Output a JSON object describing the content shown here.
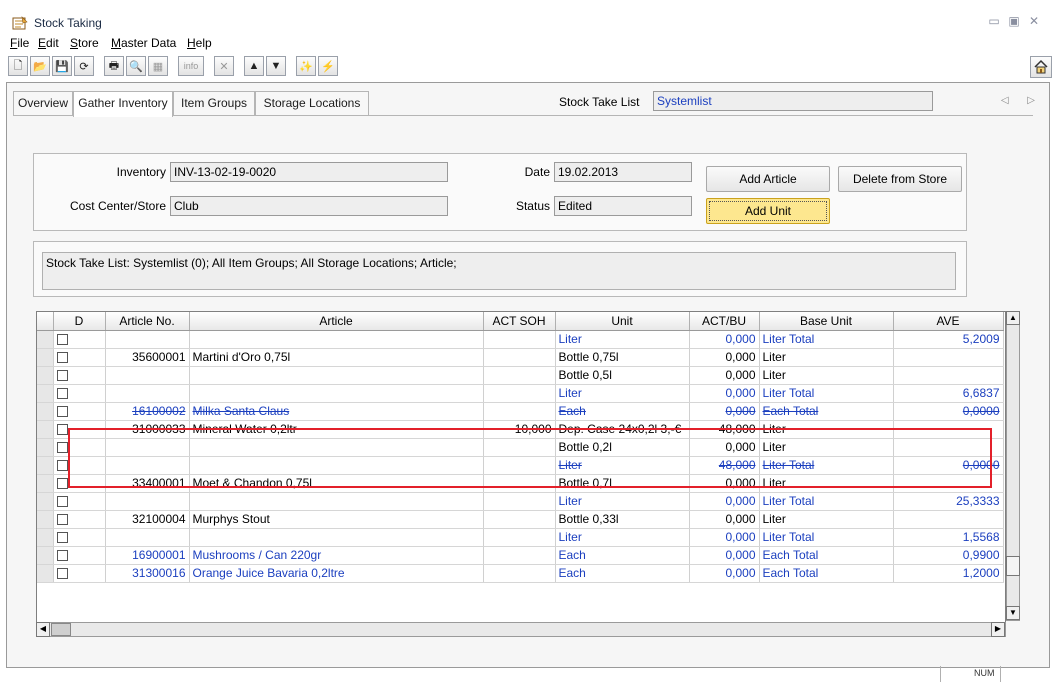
{
  "window": {
    "title": "Stock Taking",
    "controls": [
      "▭",
      "▣",
      "✕"
    ]
  },
  "menu": [
    {
      "label": "File",
      "u": "F",
      "rest": "ile"
    },
    {
      "label": "Edit",
      "u": "E",
      "rest": "dit"
    },
    {
      "label": "Store",
      "u": "S",
      "rest": "tore"
    },
    {
      "label": "Master Data",
      "u": "M",
      "rest": "aster Data"
    },
    {
      "label": "Help",
      "u": "H",
      "rest": "elp"
    }
  ],
  "toolbar": {
    "new": "🗋",
    "open": "📂",
    "save": "💾",
    "refresh": "⟳",
    "print": "🖶",
    "preview": "🔍",
    "disabled_img": "▦",
    "info": "info",
    "delete": "✕",
    "up": "▲",
    "down": "▼",
    "wand": "✨",
    "lightning": "⚡",
    "home": "⌂"
  },
  "tabs": [
    {
      "label": "Overview"
    },
    {
      "label": "Gather Inventory"
    },
    {
      "label": "Item Groups"
    },
    {
      "label": "Storage Locations"
    }
  ],
  "active_tab": "Gather Inventory",
  "stock_take_list": {
    "label": "Stock Take List",
    "value": "Systemlist"
  },
  "nav_arrows": "◁ ▷",
  "form": {
    "inventory_label": "Inventory",
    "inventory_value": "INV-13-02-19-0020",
    "cost_center_label": "Cost Center/Store",
    "cost_center_value": "Club",
    "date_label": "Date",
    "date_value": "19.02.2013",
    "status_label": "Status",
    "status_value": "Edited",
    "add_article": "Add Article",
    "delete_from_store": "Delete from Store",
    "add_unit": "Add Unit"
  },
  "filter_summary": "Stock Take List: Systemlist (0); All Item Groups; All Storage Locations; Article;",
  "grid": {
    "columns": [
      "",
      "D",
      "Article No.",
      "Article",
      "ACT SOH",
      "Unit",
      "ACT/BU",
      "Base Unit",
      "AVE"
    ],
    "rows": [
      {
        "blue": true,
        "artno": "",
        "article": "",
        "soh": "",
        "unit": "Liter",
        "actbu": "0,000",
        "base": "Liter Total",
        "ave": "5,2009"
      },
      {
        "blue": false,
        "artno": "35600001",
        "article": "Martini d'Oro 0,75l",
        "soh": "",
        "unit": "Bottle 0,75l",
        "actbu": "0,000",
        "base": "Liter",
        "ave": ""
      },
      {
        "blue": false,
        "artno": "",
        "article": "",
        "soh": "",
        "unit": "Bottle 0,5l",
        "actbu": "0,000",
        "base": "Liter",
        "ave": ""
      },
      {
        "blue": true,
        "artno": "",
        "article": "",
        "soh": "",
        "unit": "Liter",
        "actbu": "0,000",
        "base": "Liter Total",
        "ave": "6,6837"
      },
      {
        "blue": true,
        "strike": true,
        "artno": "16100002",
        "article": "Milka Santa Claus",
        "soh": "",
        "unit": "Each",
        "actbu": "0,000",
        "base": "Each Total",
        "ave": "0,0000"
      },
      {
        "blue": false,
        "artno": "31000033",
        "article": "Mineral Water 0,2ltr",
        "soh": "10,000",
        "unit": "Dep. Case 24x0,2l 3,-€",
        "actbu": "48,000",
        "base": "Liter",
        "ave": ""
      },
      {
        "blue": false,
        "artno": "",
        "article": "",
        "soh": "",
        "unit": "Bottle 0,2l",
        "actbu": "0,000",
        "base": "Liter",
        "ave": ""
      },
      {
        "blue": true,
        "strike": true,
        "artno": "",
        "article": "",
        "soh": "",
        "unit": "Liter",
        "actbu": "48,000",
        "base": "Liter Total",
        "ave": "0,0000"
      },
      {
        "blue": false,
        "artno": "33400001",
        "article": "Moet & Chandon 0,75l",
        "soh": "",
        "unit": "Bottle 0,7l",
        "actbu": "0,000",
        "base": "Liter",
        "ave": ""
      },
      {
        "blue": true,
        "artno": "",
        "article": "",
        "soh": "",
        "unit": "Liter",
        "actbu": "0,000",
        "base": "Liter Total",
        "ave": "25,3333"
      },
      {
        "blue": false,
        "artno": "32100004",
        "article": "Murphys Stout",
        "soh": "",
        "unit": "Bottle 0,33l",
        "actbu": "0,000",
        "base": "Liter",
        "ave": ""
      },
      {
        "blue": true,
        "artno": "",
        "article": "",
        "soh": "",
        "unit": "Liter",
        "actbu": "0,000",
        "base": "Liter Total",
        "ave": "1,5568"
      },
      {
        "blue": true,
        "artno": "16900001",
        "article": "Mushrooms / Can 220gr",
        "soh": "",
        "unit": "Each",
        "actbu": "0,000",
        "base": "Each Total",
        "ave": "0,9900"
      },
      {
        "blue": true,
        "artno": "31300016",
        "article": "Orange Juice Bavaria 0,2ltre",
        "soh": "",
        "unit": "Each",
        "actbu": "0,000",
        "base": "Each Total",
        "ave": "1,2000"
      }
    ]
  },
  "statusbar": {
    "num": "NUM"
  }
}
